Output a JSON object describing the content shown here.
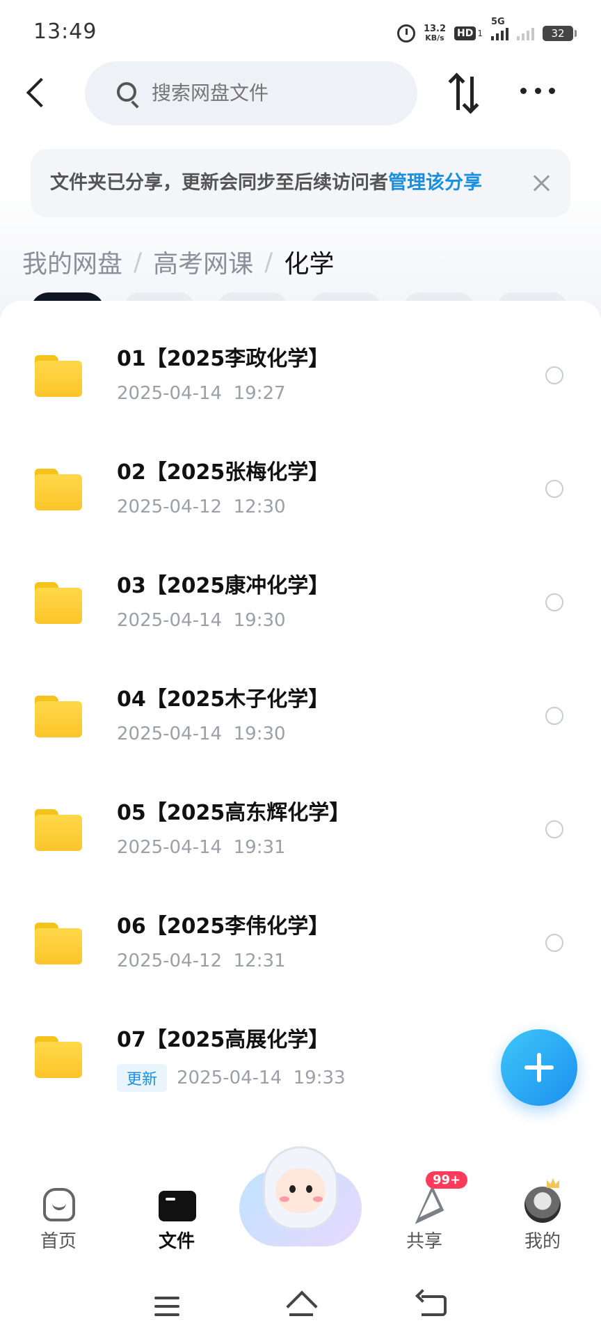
{
  "status_bar": {
    "time": "13:49",
    "net_speed_value": "13.2",
    "net_speed_unit": "KB/s",
    "hd_label": "HD",
    "sim_label": "1",
    "network_label": "5G",
    "battery": "32"
  },
  "header": {
    "search_placeholder": "搜索网盘文件"
  },
  "share_notice": {
    "text": "文件夹已分享，更新会同步至后续访问者",
    "link": "管理该分享"
  },
  "breadcrumb": {
    "items": [
      "我的网盘",
      "高考网课"
    ],
    "separator": "/",
    "current": "化学"
  },
  "files": [
    {
      "name": "01【2025李政化学】",
      "date": "2025-04-14  19:27",
      "badge": ""
    },
    {
      "name": "02【2025张梅化学】",
      "date": "2025-04-12  12:30",
      "badge": ""
    },
    {
      "name": "03【2025康冲化学】",
      "date": "2025-04-14  19:30",
      "badge": ""
    },
    {
      "name": "04【2025木子化学】",
      "date": "2025-04-14  19:30",
      "badge": ""
    },
    {
      "name": "05【2025高东辉化学】",
      "date": "2025-04-14  19:31",
      "badge": ""
    },
    {
      "name": "06【2025李伟化学】",
      "date": "2025-04-12  12:31",
      "badge": ""
    },
    {
      "name": "07【2025高展化学】",
      "date": "2025-04-14  19:33",
      "badge": "更新"
    }
  ],
  "bottom_nav": {
    "home": "首页",
    "files": "文件",
    "share": "共享",
    "share_badge": "99+",
    "mine": "我的"
  },
  "colors": {
    "accent": "#1a8fe0",
    "folder": "#fbc52a",
    "badge": "#ff3b5c"
  }
}
